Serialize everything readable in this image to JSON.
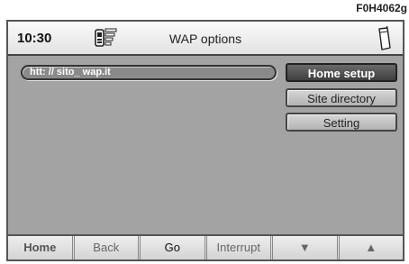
{
  "figure_code": "F0H4062g",
  "header": {
    "time": "10:30",
    "title": "WAP options",
    "signal_icon": "signal-strength-icon",
    "phone_icon": "mobile-phone-icon"
  },
  "url_field": {
    "value": "htt: // sito_ wap.it"
  },
  "menu": {
    "home_setup": "Home setup",
    "site_directory": "Site directory",
    "setting": "Setting"
  },
  "softkeys": {
    "home": "Home",
    "back": "Back",
    "go": "Go",
    "interrupt": "Interrupt",
    "down": "▼",
    "up": "▲"
  }
}
